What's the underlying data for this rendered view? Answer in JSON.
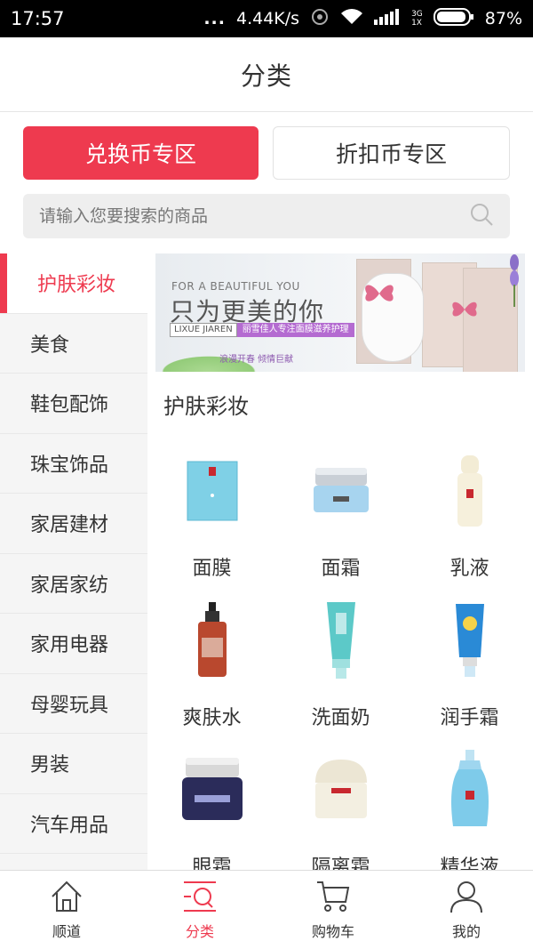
{
  "status_bar": {
    "time": "17:57",
    "dots": "...",
    "speed": "4.44K/s",
    "network": "3G",
    "network_sub": "1X",
    "battery": "87%"
  },
  "header": {
    "title": "分类"
  },
  "zones": [
    {
      "label": "兑换币专区",
      "active": true
    },
    {
      "label": "折扣币专区",
      "active": false
    }
  ],
  "search": {
    "placeholder": "请输入您要搜索的商品"
  },
  "sidebar": {
    "items": [
      {
        "label": "护肤彩妆"
      },
      {
        "label": "美食"
      },
      {
        "label": "鞋包配饰"
      },
      {
        "label": "珠宝饰品"
      },
      {
        "label": "家居建材"
      },
      {
        "label": "家居家纺"
      },
      {
        "label": "家用电器"
      },
      {
        "label": "母婴玩具"
      },
      {
        "label": "男装"
      },
      {
        "label": "汽车用品"
      }
    ]
  },
  "banner": {
    "top_line": "FOR A BEAUTIFUL YOU",
    "headline": "只为更美的你",
    "brand": "LIXUE JIAREN",
    "tagline": "丽雪佳人专注面膜滋养护理",
    "small": "浪漫开春 倾情巨献"
  },
  "section": {
    "title": "护肤彩妆"
  },
  "products": [
    {
      "name": "面膜",
      "icon": "facial-mask-icon"
    },
    {
      "name": "面霜",
      "icon": "face-cream-icon"
    },
    {
      "name": "乳液",
      "icon": "lotion-icon"
    },
    {
      "name": "爽肤水",
      "icon": "toner-icon"
    },
    {
      "name": "洗面奶",
      "icon": "cleanser-icon"
    },
    {
      "name": "润手霜",
      "icon": "hand-cream-icon"
    },
    {
      "name": "眼霜",
      "icon": "eye-cream-icon"
    },
    {
      "name": "隔离霜",
      "icon": "primer-icon"
    },
    {
      "name": "精华液",
      "icon": "serum-icon"
    }
  ],
  "bottom_nav": [
    {
      "label": "顺道",
      "icon": "home-icon"
    },
    {
      "label": "分类",
      "icon": "category-icon",
      "active": true
    },
    {
      "label": "购物车",
      "icon": "cart-icon"
    },
    {
      "label": "我的",
      "icon": "profile-icon"
    }
  ],
  "colors": {
    "accent": "#ee3a4f"
  }
}
